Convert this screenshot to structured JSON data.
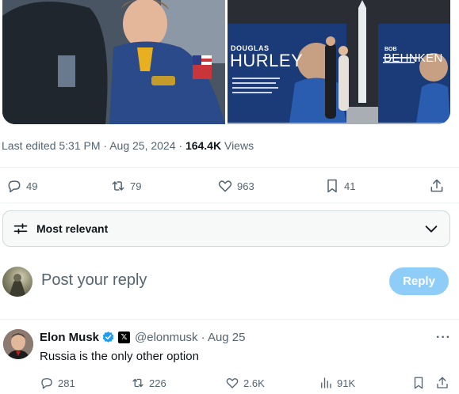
{
  "tweet": {
    "meta_time": "Last edited 5:31 PM · Aug 25, 2024 · ",
    "meta_views_count": "164.4K",
    "meta_views_label": " Views",
    "replies": "49",
    "reposts": "79",
    "likes": "963",
    "bookmarks": "41"
  },
  "photo_right_text": {
    "left_banner_first": "DOUGLAS",
    "left_banner_last": "HURLEY",
    "right_banner_first": "BOB",
    "right_banner_last": "BEHNKEN"
  },
  "sort": {
    "label": "Most relevant"
  },
  "composer": {
    "placeholder": "Post your reply",
    "button_label": "Reply"
  },
  "reply": {
    "name": "Elon Musk",
    "x_badge": "𝕏",
    "handle_date": "@elonmusk · Aug 25",
    "text": "Russia is the only other option",
    "more": "···",
    "replies": "281",
    "reposts": "226",
    "likes": "2.6K",
    "views": "91K"
  },
  "colors": {
    "accent": "#1d9bf0",
    "reply_button_disabled": "#8ecdf8",
    "secondary_text": "#536471"
  }
}
